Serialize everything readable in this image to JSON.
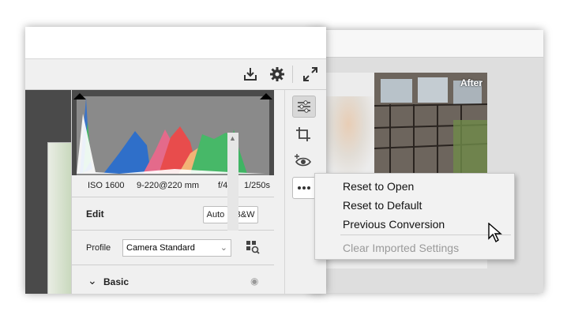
{
  "preview": {
    "after_label": "After"
  },
  "toolbar": {
    "save_icon": "download-icon",
    "settings_icon": "gear-icon",
    "fullscreen_icon": "expand-icon"
  },
  "histogram": {
    "iso": "ISO 1600",
    "lens": "9-220@220 mm",
    "aperture": "f/4",
    "shutter": "1/250s"
  },
  "edit": {
    "title": "Edit",
    "auto_label": "Auto",
    "bw_label": "B&W"
  },
  "profile": {
    "label": "Profile",
    "value": "Camera Standard"
  },
  "basic": {
    "title": "Basic"
  },
  "tools": [
    "sliders-icon",
    "crop-icon",
    "redeye-icon",
    "more-icon"
  ],
  "context_menu": {
    "items": [
      "Reset to Open",
      "Reset to Default",
      "Previous Conversion"
    ],
    "disabled_item": "Clear Imported Settings"
  }
}
